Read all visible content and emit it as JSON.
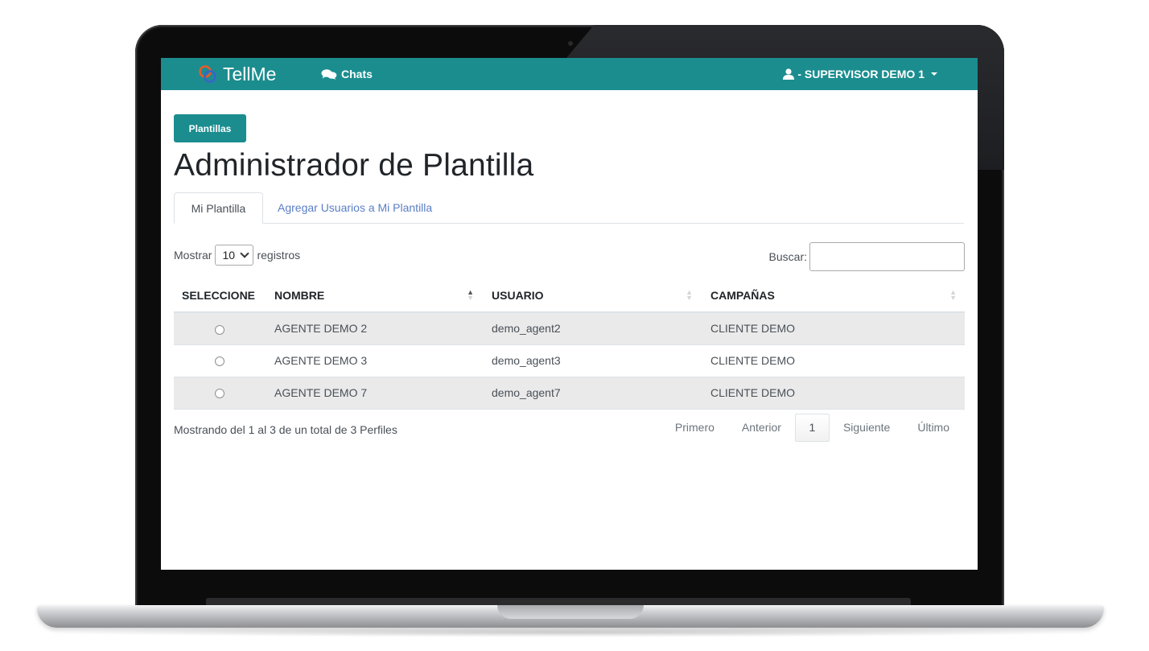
{
  "navbar": {
    "brand": "TellMe",
    "chats_label": "Chats",
    "user_label": "- SUPERVISOR DEMO 1"
  },
  "page": {
    "button_label": "Plantillas",
    "title": "Administrador de Plantilla"
  },
  "tabs": [
    {
      "label": "Mi Plantilla",
      "active": true
    },
    {
      "label": "Agregar Usuarios a Mi Plantilla",
      "active": false
    }
  ],
  "table_controls": {
    "show_prefix": "Mostrar",
    "page_length": "10",
    "show_suffix": "registros",
    "search_label": "Buscar:",
    "search_value": ""
  },
  "table": {
    "columns": [
      "SELECCIONE",
      "NOMBRE",
      "USUARIO",
      "CAMPAÑAS"
    ],
    "rows": [
      {
        "nombre": "AGENTE DEMO 2",
        "usuario": "demo_agent2",
        "campanas": "CLIENTE DEMO"
      },
      {
        "nombre": "AGENTE DEMO 3",
        "usuario": "demo_agent3",
        "campanas": "CLIENTE DEMO"
      },
      {
        "nombre": "AGENTE DEMO 7",
        "usuario": "demo_agent7",
        "campanas": "CLIENTE DEMO"
      }
    ]
  },
  "footer": {
    "info": "Mostrando del 1 al 3 de un total de 3 Perfiles",
    "pagination": {
      "first": "Primero",
      "previous": "Anterior",
      "current": "1",
      "next": "Siguiente",
      "last": "Último"
    }
  },
  "colors": {
    "navbar": "#1b8d8f",
    "link": "#5b7ec6",
    "striped_row": "#eaeaea"
  },
  "icons": {
    "brand": "tellme-logo-icon",
    "chats": "comments-icon",
    "user": "user-icon",
    "dropdown": "caret-down-icon",
    "sort": "sort-arrows-icon"
  }
}
